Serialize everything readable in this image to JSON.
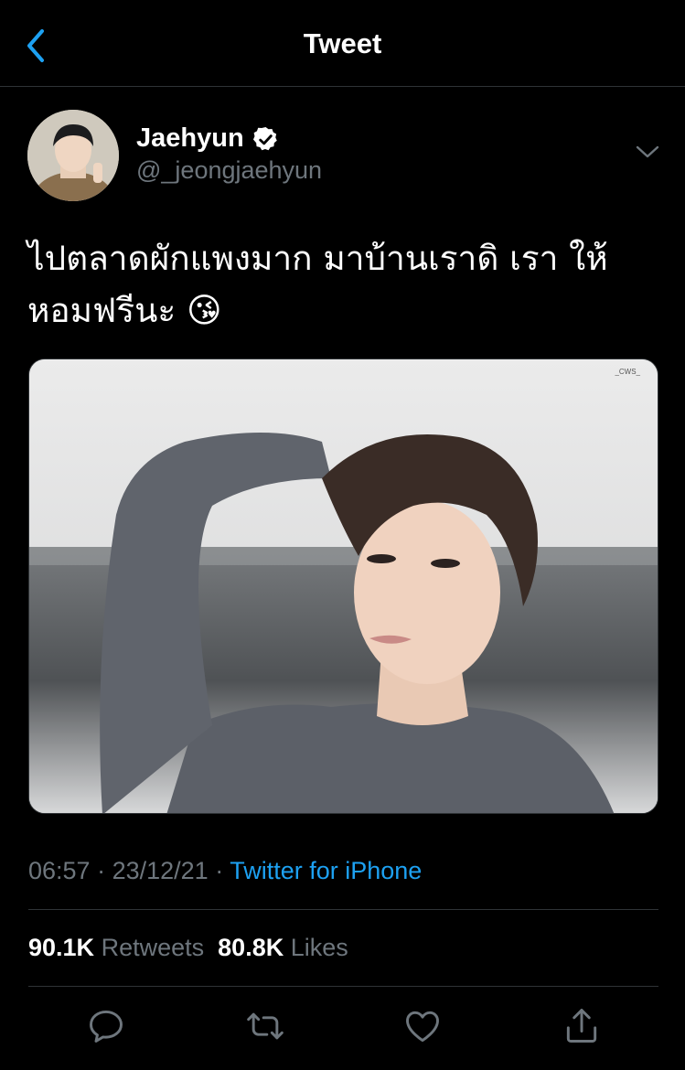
{
  "header": {
    "title": "Tweet",
    "back_icon": "chevron-left-icon",
    "accent": "#1da1f2"
  },
  "author": {
    "name": "Jaehyun",
    "handle": "@_jeongjaehyun",
    "verified_icon": "verified-badge-icon"
  },
  "tweet": {
    "line1": "ไปตลาดผักแพงมาก มาบ้านเราดิ เรา ให้",
    "line2": "หอมฟรีนะ ",
    "emoji": "😘"
  },
  "media": {
    "watermark": "_CWS_"
  },
  "meta": {
    "time": "06:57",
    "sep": " · ",
    "date": "23/12/21",
    "source": "Twitter for iPhone"
  },
  "stats": {
    "retweets_count": "90.1K",
    "retweets_label": "Retweets",
    "likes_count": "80.8K",
    "likes_label": "Likes"
  },
  "actions": [
    "reply-icon",
    "retweet-icon",
    "like-icon",
    "share-icon"
  ]
}
